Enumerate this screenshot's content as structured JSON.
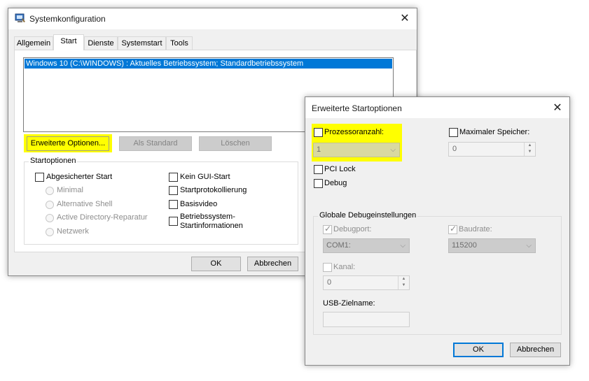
{
  "main_window": {
    "title": "Systemkonfiguration",
    "close_glyph": "✕",
    "tabs": [
      {
        "label": "Allgemein"
      },
      {
        "label": "Start"
      },
      {
        "label": "Dienste"
      },
      {
        "label": "Systemstart"
      },
      {
        "label": "Tools"
      }
    ],
    "boot_entries": [
      "Windows 10 (C:\\WINDOWS) : Aktuelles Betriebssystem; Standardbetriebssystem"
    ],
    "buttons": {
      "advanced": "Erweiterte Optionen...",
      "set_default": "Als Standard",
      "delete": "Löschen",
      "ok": "OK",
      "cancel": "Abbrechen"
    },
    "startoptions": {
      "title": "Startoptionen",
      "safe_boot": "Abgesicherter Start",
      "radios": [
        "Minimal",
        "Alternative Shell",
        "Active Directory-Reparatur",
        "Netzwerk"
      ],
      "no_gui": "Kein GUI-Start",
      "boot_log": "Startprotokollierung",
      "base_video": "Basisvideo",
      "os_info_line1": "Betriebssystem-",
      "os_info_line2": "Startinformationen"
    }
  },
  "advanced_dialog": {
    "title": "Erweiterte Startoptionen",
    "close_glyph": "✕",
    "processor_count_label": "Prozessoranzahl:",
    "processor_count_value": "1",
    "max_memory_label": "Maximaler Speicher:",
    "max_memory_value": "0",
    "pci_lock": "PCI Lock",
    "debug": "Debug",
    "debug_settings": {
      "title": "Globale Debugeinstellungen",
      "debugport_label": "Debugport:",
      "debugport_value": "COM1:",
      "baudrate_label": "Baudrate:",
      "baudrate_value": "115200",
      "channel_label": "Kanal:",
      "channel_value": "0",
      "usb_target_label": "USB-Zielname:",
      "usb_target_value": ""
    },
    "buttons": {
      "ok": "OK",
      "cancel": "Abbrechen"
    }
  },
  "colors": {
    "highlight": "#ffff00",
    "selection": "#0078d7",
    "accent_border": "#0078d7"
  }
}
